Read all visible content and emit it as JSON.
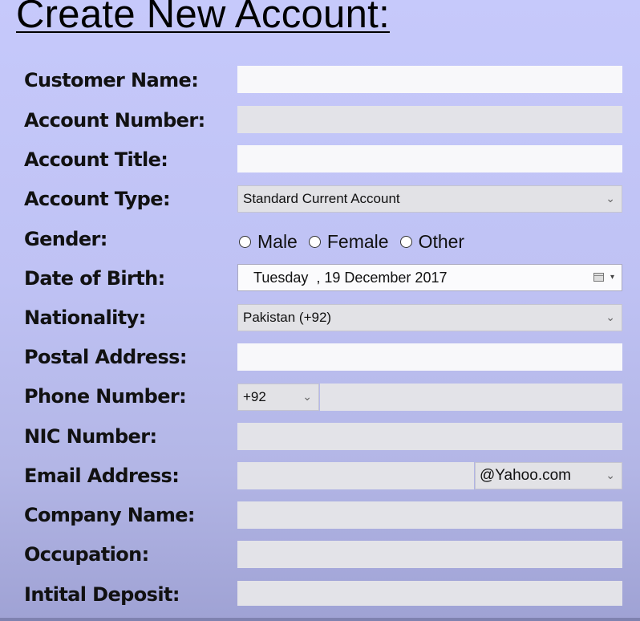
{
  "title": "Create New Account:",
  "labels": {
    "customer_name": "Customer Name:",
    "account_number": "Account Number:",
    "account_title": "Account Title:",
    "account_type": "Account Type:",
    "gender": "Gender:",
    "date_of_birth": "Date of Birth:",
    "nationality": "Nationality:",
    "postal_address": "Postal Address:",
    "phone_number": "Phone Number:",
    "nic_number": "NIC Number:",
    "email_address": "Email Address:",
    "company_name": "Company Name:",
    "occupation": "Occupation:",
    "initial_deposit": "Intital Deposit:"
  },
  "fields": {
    "customer_name": "",
    "account_number": "",
    "account_title": "",
    "account_type": "Standard Current Account",
    "gender_options": [
      "Male",
      "Female",
      "Other"
    ],
    "date_of_birth": "Tuesday  , 19 December 2017",
    "nationality": "Pakistan (+92)",
    "postal_address": "",
    "phone_code": "+92",
    "phone_number": "",
    "nic_number": "",
    "email_user": "",
    "email_domain": "@Yahoo.com",
    "company_name": "",
    "occupation": "",
    "initial_deposit": ""
  },
  "icons": {
    "dropdown": "chevron-down-icon",
    "calendar": "calendar-icon",
    "radio": "radio-unchecked-icon"
  },
  "colors": {
    "background": "#c6c9fb",
    "field": "#e3e3e8",
    "field_white": "#f8f8fa"
  }
}
